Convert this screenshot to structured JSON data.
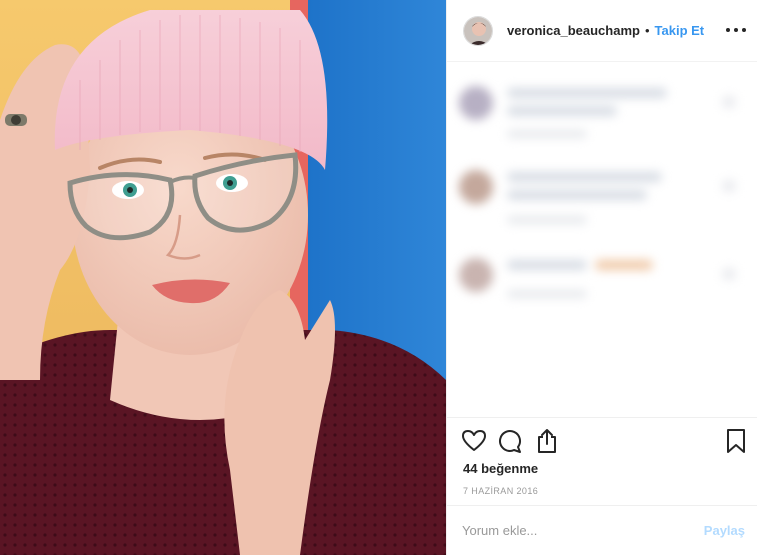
{
  "post": {
    "image_alt": "Portrait of a young woman in a pink knit beanie and clear-frame glasses",
    "header": {
      "username": "veronica_beauchamp",
      "separator": "•",
      "follow_label": "Takip Et",
      "more_icon": "more-options-icon"
    },
    "actions": {
      "like_icon": "heart-icon",
      "comment_icon": "comment-icon",
      "share_icon": "share-icon",
      "save_icon": "bookmark-icon"
    },
    "likes_text": "44 beğenme",
    "date_text": "7 HAZİRAN 2016",
    "comment_box": {
      "placeholder": "Yorum ekle...",
      "submit_label": "Paylaş"
    },
    "colors": {
      "link": "#3897f0",
      "submit_disabled": "#b3dbff",
      "text": "#262626",
      "muted": "#999999"
    }
  }
}
